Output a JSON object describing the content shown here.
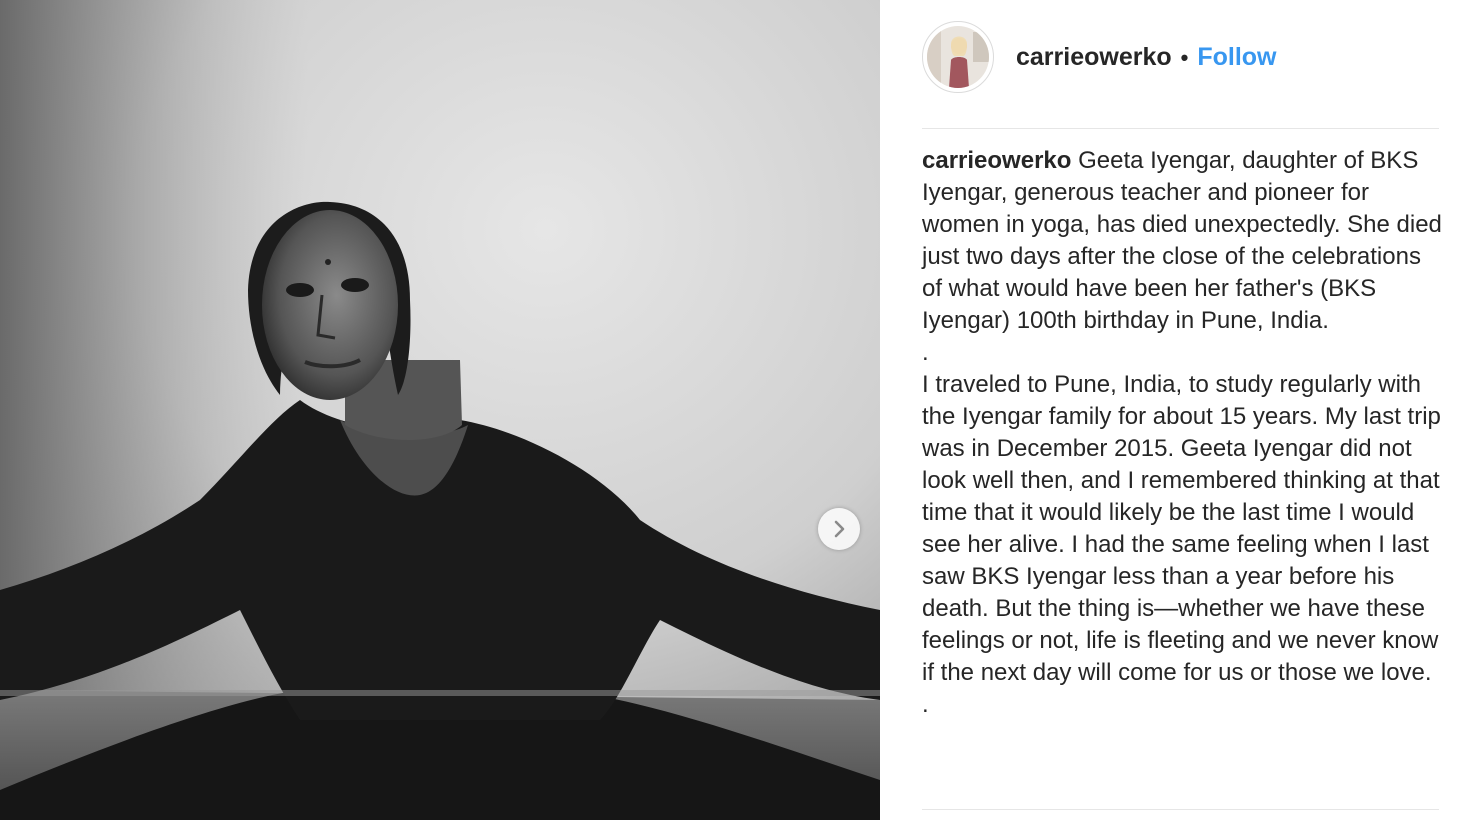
{
  "post": {
    "username": "carrieowerko",
    "separator": "•",
    "follow_label": "Follow",
    "caption_username": "carrieowerko",
    "caption_paragraphs": [
      "Geeta Iyengar, daughter of BKS Iyengar, generous teacher and pioneer for women in yoga, has died unexpectedly. She died just two days after the close of the celebrations of what would have been her father's (BKS Iyengar) 100th birthday in Pune, India.",
      ".",
      "I traveled to Pune, India, to study regularly with the Iyengar family for about 15 years. My last trip was in December 2015. Geeta Iyengar did not look well then, and I remembered thinking at that time that it would likely be the last time I would see her alive. I had the same feeling when I last saw BKS Iyengar less than a year before his death. But the thing is—whether we have these feelings or not, life is fleeting and we never know if the next day will come for us or those we love.",
      "."
    ],
    "next_icon": "chevron-right-icon",
    "photo_description_icon": "black-and-white-photo",
    "colors": {
      "follow": "#3897f0",
      "text": "#262626",
      "divider": "#e6e6e6"
    }
  }
}
